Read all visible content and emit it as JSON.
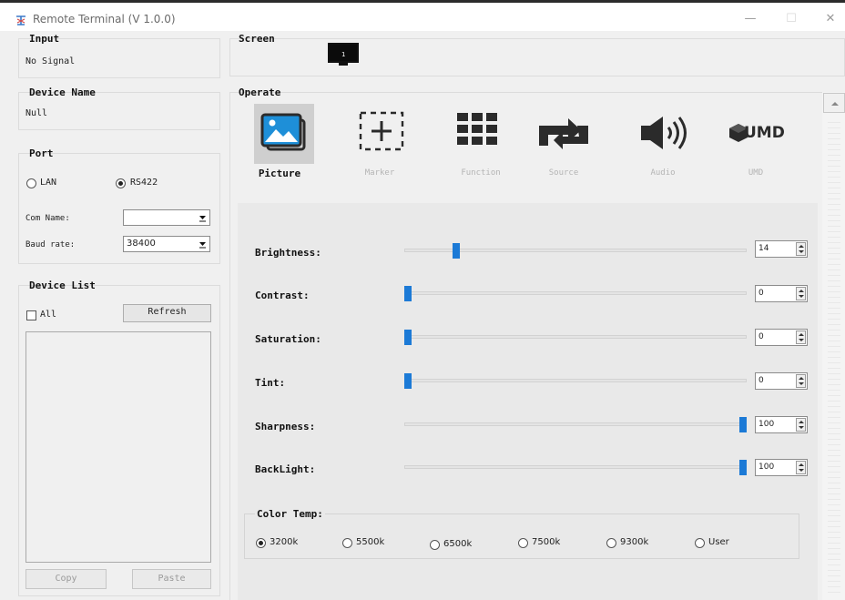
{
  "window": {
    "title": "Remote Terminal (V 1.0.0)",
    "minimize_icon": "minimize-icon",
    "maximize_icon": "maximize-icon",
    "close_icon": "close-icon"
  },
  "input": {
    "label": "Input",
    "value": "No Signal"
  },
  "device_name": {
    "label": "Device Name",
    "value": "Null"
  },
  "port": {
    "label": "Port",
    "options": [
      "LAN",
      "RS422"
    ],
    "selected": "RS422",
    "com_name_label": "Com Name:",
    "com_name_value": "",
    "baud_rate_label": "Baud rate:",
    "baud_rate_value": "38400"
  },
  "device_list": {
    "label": "Device List",
    "all_label": "All",
    "refresh_label": "Refresh",
    "copy_label": "Copy",
    "paste_label": "Paste"
  },
  "screen": {
    "label": "Screen",
    "monitor_number": "1"
  },
  "operate": {
    "label": "Operate",
    "tabs": [
      {
        "label": "Picture",
        "icon": "picture-icon",
        "active": true
      },
      {
        "label": "Marker",
        "icon": "marker-icon",
        "active": false
      },
      {
        "label": "Function",
        "icon": "function-icon",
        "active": false
      },
      {
        "label": "Source",
        "icon": "source-icon",
        "active": false
      },
      {
        "label": "Audio",
        "icon": "audio-icon",
        "active": false
      },
      {
        "label": "UMD",
        "icon": "umd-icon",
        "active": false
      }
    ],
    "umd_logo_text": "UMD"
  },
  "picture": {
    "sliders": [
      {
        "label": "Brightness:",
        "value": "14",
        "fraction": 0.145
      },
      {
        "label": "Contrast:",
        "value": "0",
        "fraction": 0.0
      },
      {
        "label": "Saturation:",
        "value": "0",
        "fraction": 0.0
      },
      {
        "label": "Tint:",
        "value": "0",
        "fraction": 0.0
      },
      {
        "label": "Sharpness:",
        "value": "100",
        "fraction": 1.0
      },
      {
        "label": "BackLight:",
        "value": "100",
        "fraction": 1.0
      }
    ],
    "color_temp": {
      "label": "Color Temp:",
      "options": [
        "3200k",
        "5500k",
        "6500k",
        "7500k",
        "9300k",
        "User"
      ],
      "selected": "3200k"
    }
  },
  "colors": {
    "accent": "#1c7ad6",
    "panel": "#f0f0f0",
    "active_tab_bg": "#cfcfcf"
  }
}
